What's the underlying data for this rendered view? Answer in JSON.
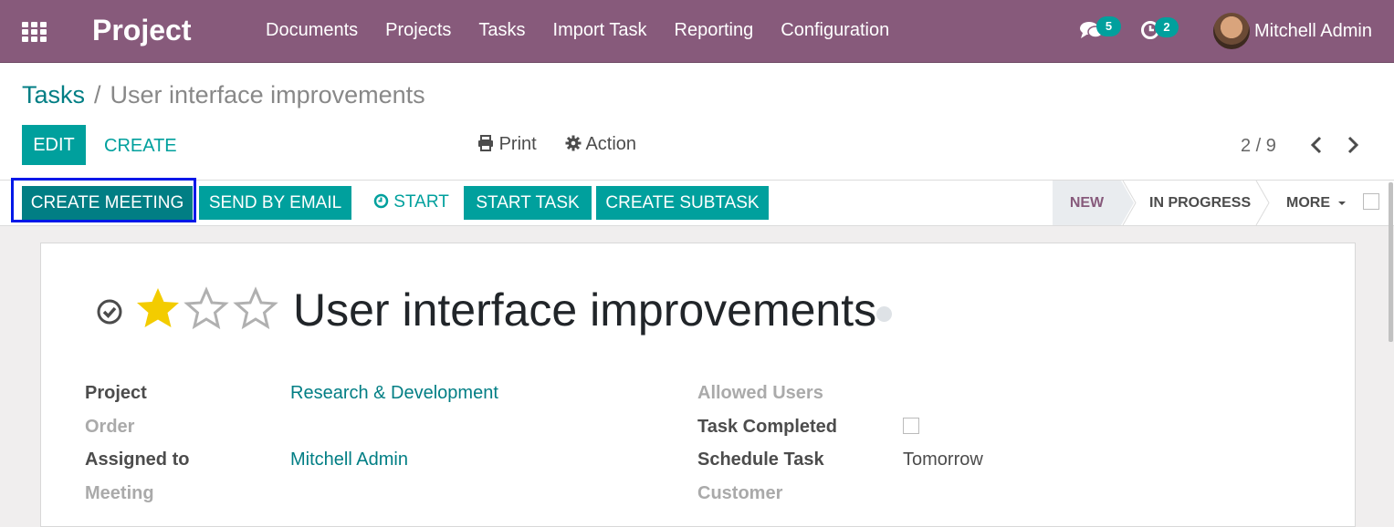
{
  "navbar": {
    "brand": "Project",
    "menu": [
      "Documents",
      "Projects",
      "Tasks",
      "Import Task",
      "Reporting",
      "Configuration"
    ],
    "messages_count": "5",
    "activities_count": "2",
    "user_name": "Mitchell Admin"
  },
  "breadcrumb": {
    "parent": "Tasks",
    "separator": "/",
    "current": "User interface improvements"
  },
  "buttons": {
    "edit": "EDIT",
    "create": "CREATE",
    "print": "Print",
    "action": "Action"
  },
  "pager": {
    "value": "2 / 9"
  },
  "statusbar": {
    "create_meeting": "CREATE MEETING",
    "send_by_email": "SEND BY EMAIL",
    "start": "START",
    "start_task": "START TASK",
    "create_subtask": "CREATE SUBTASK",
    "stages": [
      "NEW",
      "IN PROGRESS"
    ],
    "more": "MORE"
  },
  "task": {
    "title": "User interface improvements",
    "priority_stars": 1,
    "priority_max": 3
  },
  "fields_left": [
    {
      "label": "Project",
      "value": "Research & Development",
      "muted": false,
      "link": true
    },
    {
      "label": "Order",
      "value": "",
      "muted": true,
      "link": false
    },
    {
      "label": "Assigned to",
      "value": "Mitchell Admin",
      "muted": false,
      "link": true
    },
    {
      "label": "Meeting",
      "value": "",
      "muted": true,
      "link": false
    }
  ],
  "fields_right": [
    {
      "label": "Allowed Users",
      "value": "",
      "muted": true
    },
    {
      "label": "Task Completed",
      "value": "",
      "muted": false
    },
    {
      "label": "Schedule Task",
      "value": "Tomorrow",
      "muted": false
    },
    {
      "label": "Customer",
      "value": "",
      "muted": true
    }
  ],
  "colors": {
    "navbar": "#875a7b",
    "primary": "#00a09d",
    "link": "#017e84",
    "star_filled": "#f3cc00",
    "highlight": "#0018e8"
  }
}
